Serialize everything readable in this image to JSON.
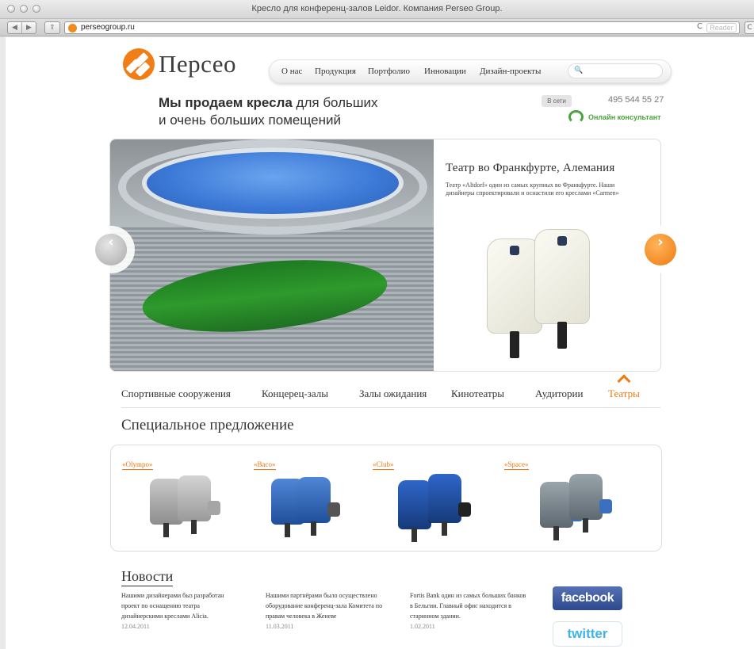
{
  "browser": {
    "window_title": "Кресло для конференц-залов Leidor. Компания Perseo Group.",
    "url": "perseogroup.ru",
    "reader_label": "Reader",
    "nav_back": "◀",
    "nav_forward": "▶",
    "share": "⇪",
    "reload": "C",
    "edge": "C"
  },
  "header": {
    "logo_text": "Персео",
    "nav": [
      "О нас",
      "Продукция",
      "Портфолио",
      "Инновации",
      "Дизайн-проекты"
    ],
    "search_icon": "🔍"
  },
  "slogan": {
    "bold": "Мы продаем кресла",
    "rest1": " для больших",
    "line2": "и очень больших помещений"
  },
  "contact": {
    "status": "В сети",
    "phone": "495 544 55 27",
    "consultant": "Онлайн консультант"
  },
  "slide": {
    "title": "Театр во Франкфурте, Алемания",
    "description": "Театр «Altdorf» один из самых крупных во Франкфурте. Наши дизайнеры спроектировали и оснастили его креслами «Carmen»"
  },
  "arrows": {
    "prev": "‹",
    "next": "›"
  },
  "categories": [
    {
      "label": "Спортивные сооружения",
      "active": false
    },
    {
      "label": "Концерец-залы",
      "active": false
    },
    {
      "label": "Залы ожидания",
      "active": false
    },
    {
      "label": "Кинотеатры",
      "active": false
    },
    {
      "label": "Аудитории",
      "active": false
    },
    {
      "label": "Театры",
      "active": true
    }
  ],
  "special": {
    "title": "Специальное предложение",
    "offers": [
      "«Olympo»",
      "«Baco»",
      "«Club»",
      "«Space»"
    ]
  },
  "news": {
    "title": "Новости",
    "items": [
      {
        "text": "Нашими дизайнерами быз разработан проект по оснащению театра дизайнерскими креслами Alicia.",
        "date": "12.04.2011"
      },
      {
        "text": "Нашими партнёрами было осуществлено оборудование конференц-зала Комитета по правам человека в Женеве",
        "date": "11.03.2011"
      },
      {
        "text": "Fortis Bank один из самых больших банков в Бельгии. Главный офис находится в старинном здании.",
        "date": "1.02.2011"
      }
    ]
  },
  "social": {
    "facebook": "facebook",
    "twitter": "twitter"
  }
}
